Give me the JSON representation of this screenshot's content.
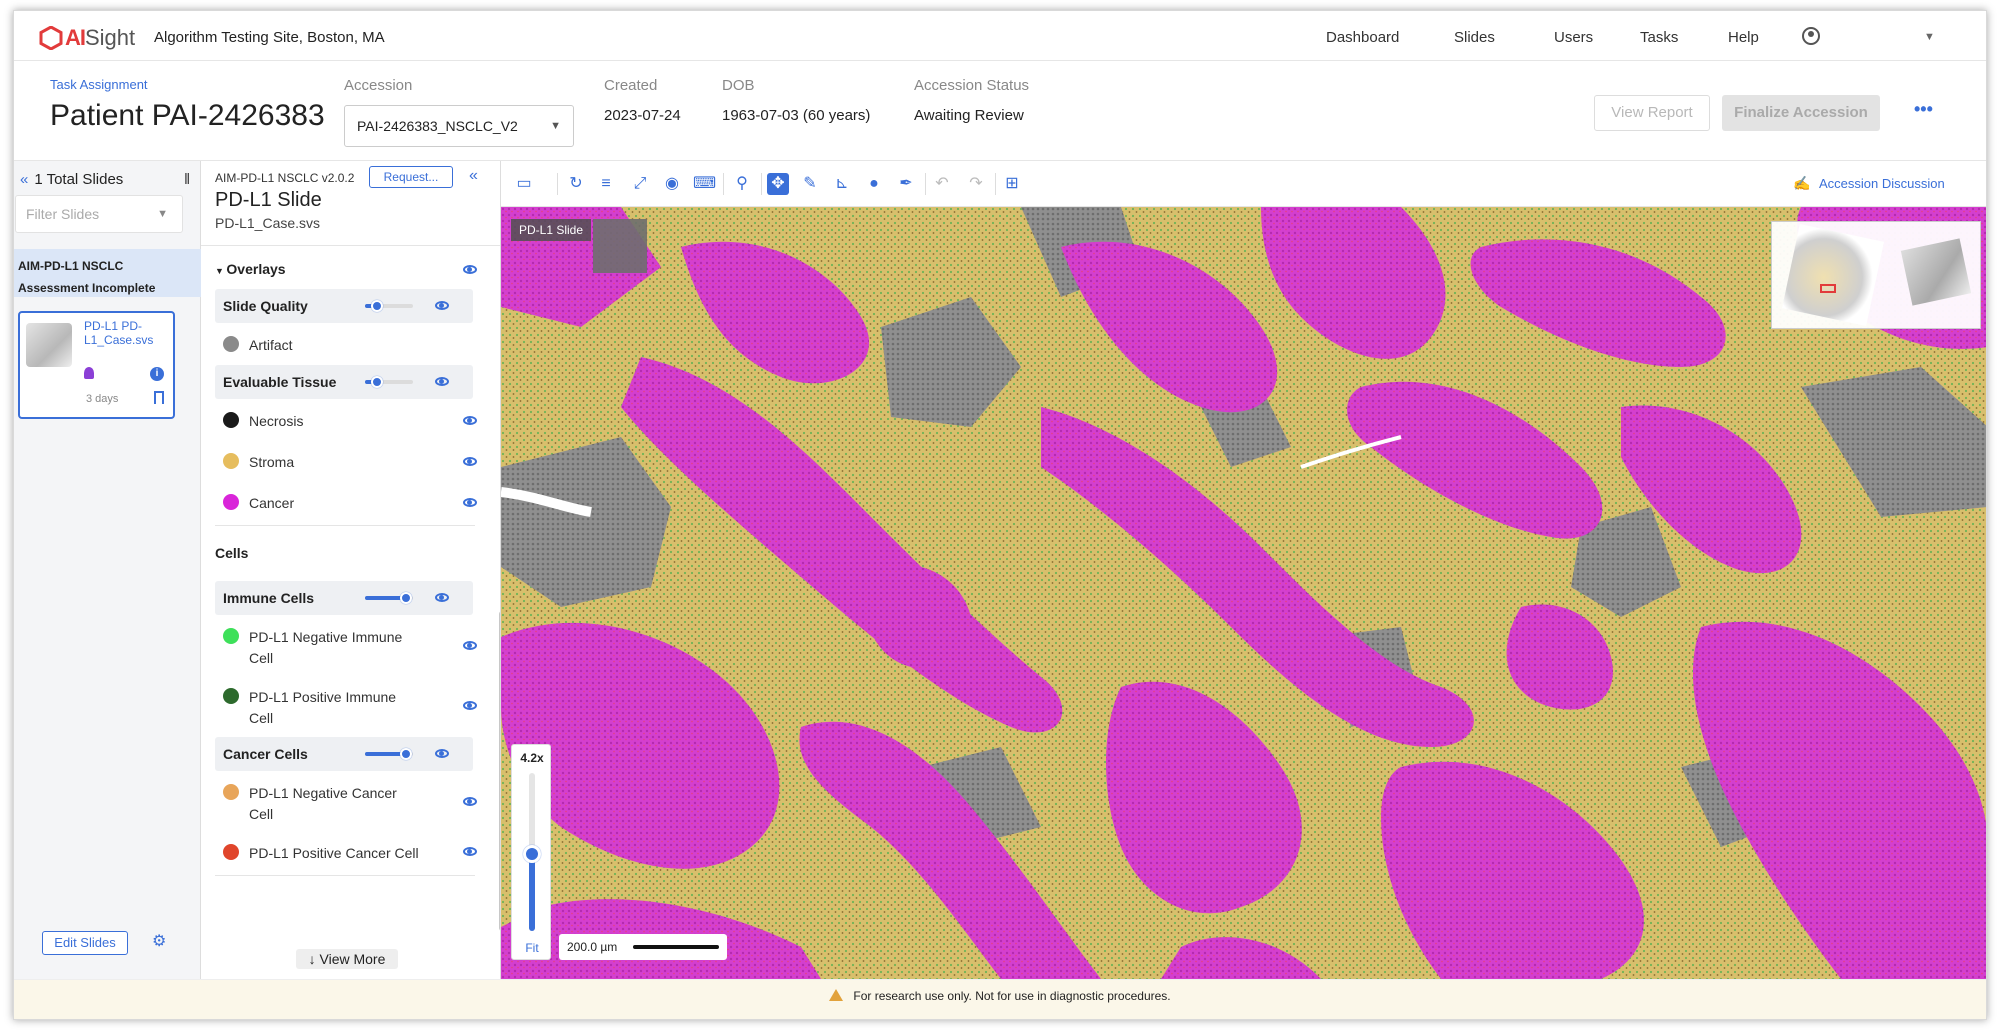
{
  "app": {
    "logo_ai": "AI",
    "logo_sight": "Sight",
    "site": "Algorithm Testing Site, Boston, MA"
  },
  "nav": [
    "Dashboard",
    "Slides",
    "Users",
    "Tasks",
    "Help"
  ],
  "header": {
    "breadcrumb": "Task Assignment",
    "patient": "Patient PAI-2426383",
    "accession_label": "Accession",
    "accession_value": "PAI-2426383_NSCLC_V2",
    "created_label": "Created",
    "created_value": "2023-07-24",
    "dob_label": "DOB",
    "dob_value": "1963-07-03 (60 years)",
    "status_label": "Accession Status",
    "status_value": "Awaiting Review",
    "view_report": "View Report",
    "finalize": "Finalize Accession",
    "more": "•••"
  },
  "left": {
    "total": "1 Total Slides",
    "filter_placeholder": "Filter Slides",
    "case_line1": "AIM-PD-L1 NSCLC",
    "case_line2": "Assessment Incomplete",
    "thumb_name": "PD-L1 PD-L1_Case.svs",
    "thumb_days": "3 days",
    "edit": "Edit Slides"
  },
  "overlays": {
    "algo": "AIM-PD-L1 NSCLC v2.0.2",
    "request": "Request...",
    "title": "PD-L1 Slide",
    "file": "PD-L1_Case.svs",
    "section": "Overlays",
    "slide_quality": "Slide Quality",
    "artifact": "Artifact",
    "evaluable": "Evaluable Tissue",
    "necrosis": "Necrosis",
    "stroma": "Stroma",
    "cancer": "Cancer",
    "cells": "Cells",
    "immune": "Immune Cells",
    "neg_immune": "PD-L1 Negative Immune Cell",
    "pos_immune": "PD-L1 Positive Immune Cell",
    "cancer_cells": "Cancer Cells",
    "neg_cancer": "PD-L1 Negative Cancer Cell",
    "pos_cancer": "PD-L1 Positive Cancer Cell",
    "view_more": "View More",
    "colors": {
      "artifact": "#8a8a8a",
      "necrosis": "#1a1a1a",
      "stroma": "#e6bd5e",
      "cancer": "#d925d9",
      "neg_immune": "#3ee05a",
      "pos_immune": "#2d6a2d",
      "neg_cancer": "#e8a55a",
      "pos_cancer": "#e0452b"
    },
    "slider_levels": {
      "slide_quality": 0.25,
      "evaluable": 0.25,
      "immune": 0.85,
      "cancer_cells": 0.85
    }
  },
  "viewer": {
    "discussion": "Accession Discussion",
    "slide_tag": "PD-L1 Slide",
    "zoom": "4.2x",
    "fit": "Fit",
    "scale": "200.0 µm"
  },
  "footer": {
    "warning": "For research use only. Not for use in diagnostic procedures."
  }
}
